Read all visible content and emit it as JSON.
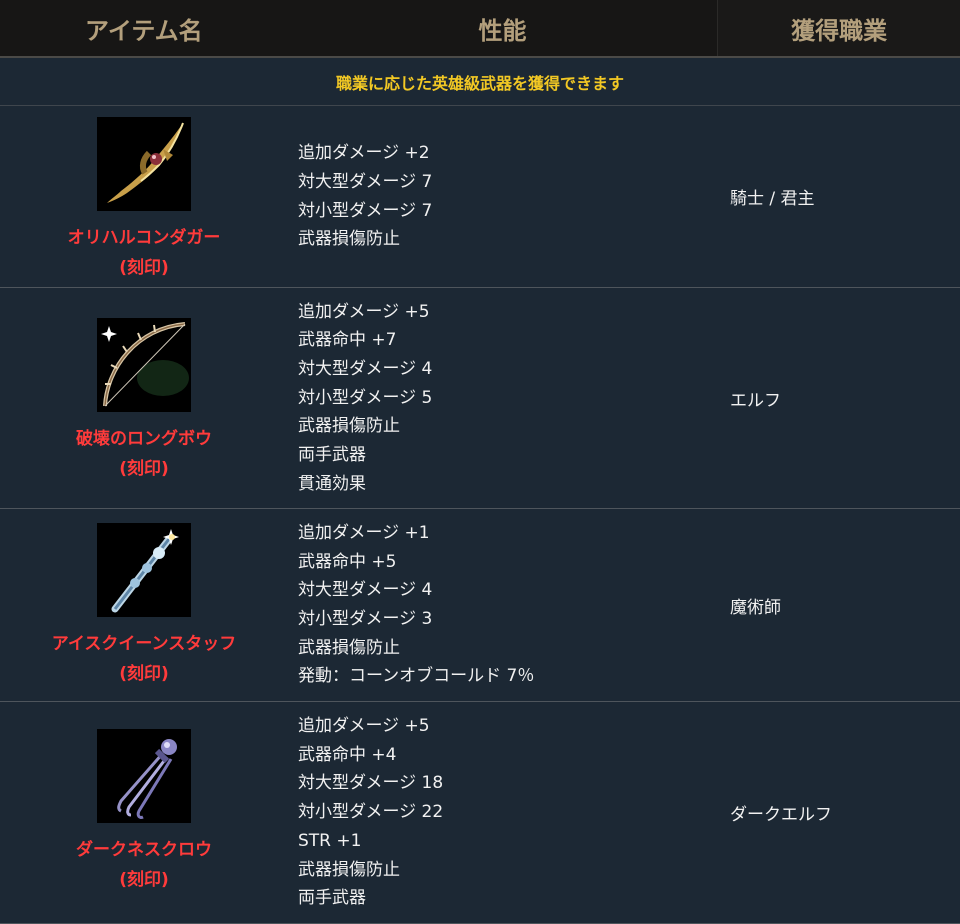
{
  "header": {
    "col_item": "アイテム名",
    "col_perf": "性能",
    "col_job": "獲得職業"
  },
  "notice": "職業に応じた英雄級武器を獲得できます",
  "items": [
    {
      "name": "オリハルコンダガー",
      "tag": "(刻印)",
      "icon": "dagger-icon",
      "stats": [
        "追加ダメージ +2",
        "対大型ダメージ 7",
        "対小型ダメージ 7",
        "武器損傷防止"
      ],
      "job": "騎士 / 君主"
    },
    {
      "name": "破壊のロングボウ",
      "tag": "(刻印)",
      "icon": "longbow-icon",
      "stats": [
        "追加ダメージ +5",
        "武器命中 +7",
        "対大型ダメージ 4",
        "対小型ダメージ 5",
        "武器損傷防止",
        "両手武器",
        "貫通効果"
      ],
      "job": "エルフ"
    },
    {
      "name": "アイスクイーンスタッフ",
      "tag": "(刻印)",
      "icon": "staff-icon",
      "stats": [
        "追加ダメージ +1",
        "武器命中 +5",
        "対大型ダメージ 4",
        "対小型ダメージ 3",
        "武器損傷防止",
        "発動：コーンオブコールド 7％"
      ],
      "job": "魔術師"
    },
    {
      "name": "ダークネスクロウ",
      "tag": "(刻印)",
      "icon": "claw-icon",
      "stats": [
        "追加ダメージ +5",
        "武器命中 +4",
        "対大型ダメージ 18",
        "対小型ダメージ 22",
        "STR +1",
        "武器損傷防止",
        "両手武器"
      ],
      "job": "ダークエルフ"
    }
  ],
  "colors": {
    "header_text": "#b39f7c",
    "notice_text": "#f2c824",
    "item_name": "#ff3b3b",
    "body_text": "#f1f1f1",
    "row_bg": "#1c2834"
  }
}
